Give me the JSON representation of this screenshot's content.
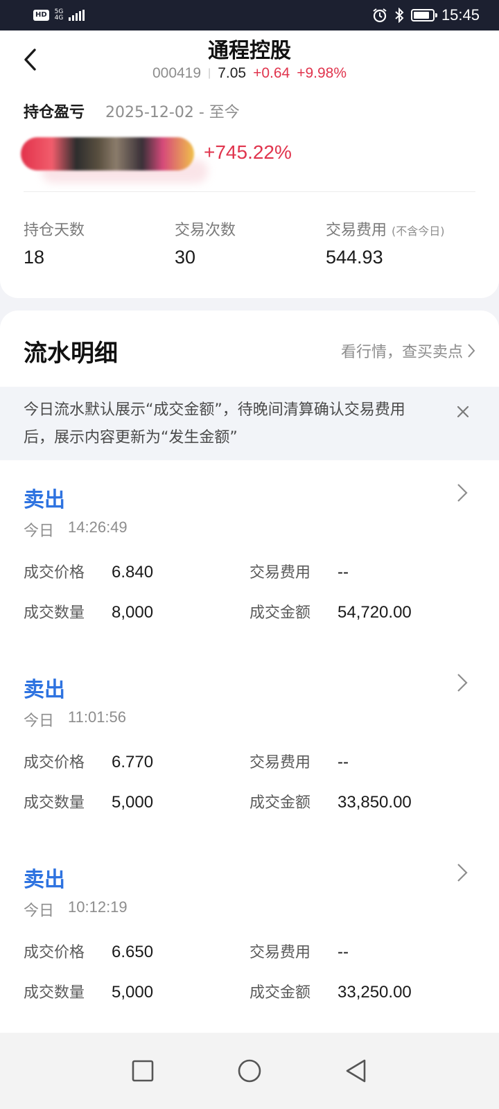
{
  "status_bar": {
    "hd": "HD",
    "network_top": "5G",
    "network_bottom": "4G",
    "time": "15:45"
  },
  "header": {
    "stock_name": "通程控股",
    "code": "000419",
    "price": "7.05",
    "change": "+0.64",
    "change_pct": "+9.98%"
  },
  "summary": {
    "pl_label": "持仓盈亏",
    "pl_range": "2025-12-02 - 至今",
    "pl_pct": "+745.22%",
    "stats": [
      {
        "label": "持仓天数",
        "note": "",
        "value": "18"
      },
      {
        "label": "交易次数",
        "note": "",
        "value": "30"
      },
      {
        "label": "交易费用",
        "note": "(不含今日)",
        "value": "544.93"
      }
    ]
  },
  "flow": {
    "title": "流水明细",
    "market_link": "看行情，查买卖点",
    "notice": "今日流水默认展示“成交金额”，待晚间清算确认交易费用后，展示内容更新为“发生金额”",
    "trades": [
      {
        "type": "卖出",
        "day": "今日",
        "time": "14:26:49",
        "price_label": "成交价格",
        "price": "6.840",
        "fee_label": "交易费用",
        "fee": "--",
        "qty_label": "成交数量",
        "qty": "8,000",
        "amount_label": "成交金额",
        "amount": "54,720.00"
      },
      {
        "type": "卖出",
        "day": "今日",
        "time": "11:01:56",
        "price_label": "成交价格",
        "price": "6.770",
        "fee_label": "交易费用",
        "fee": "--",
        "qty_label": "成交数量",
        "qty": "5,000",
        "amount_label": "成交金额",
        "amount": "33,850.00"
      },
      {
        "type": "卖出",
        "day": "今日",
        "time": "10:12:19",
        "price_label": "成交价格",
        "price": "6.650",
        "fee_label": "交易费用",
        "fee": "--",
        "qty_label": "成交数量",
        "qty": "5,000",
        "amount_label": "成交金额",
        "amount": "33,250.00"
      }
    ]
  },
  "colors": {
    "up": "#e0344d",
    "accent_blue": "#2e73e0",
    "status_bar_bg": "#1c2030"
  },
  "icons": [
    "back-icon",
    "chevron-right-icon",
    "close-icon",
    "alarm-icon",
    "bluetooth-icon",
    "battery-icon",
    "recent-apps-icon",
    "home-icon",
    "back-triangle-icon"
  ]
}
